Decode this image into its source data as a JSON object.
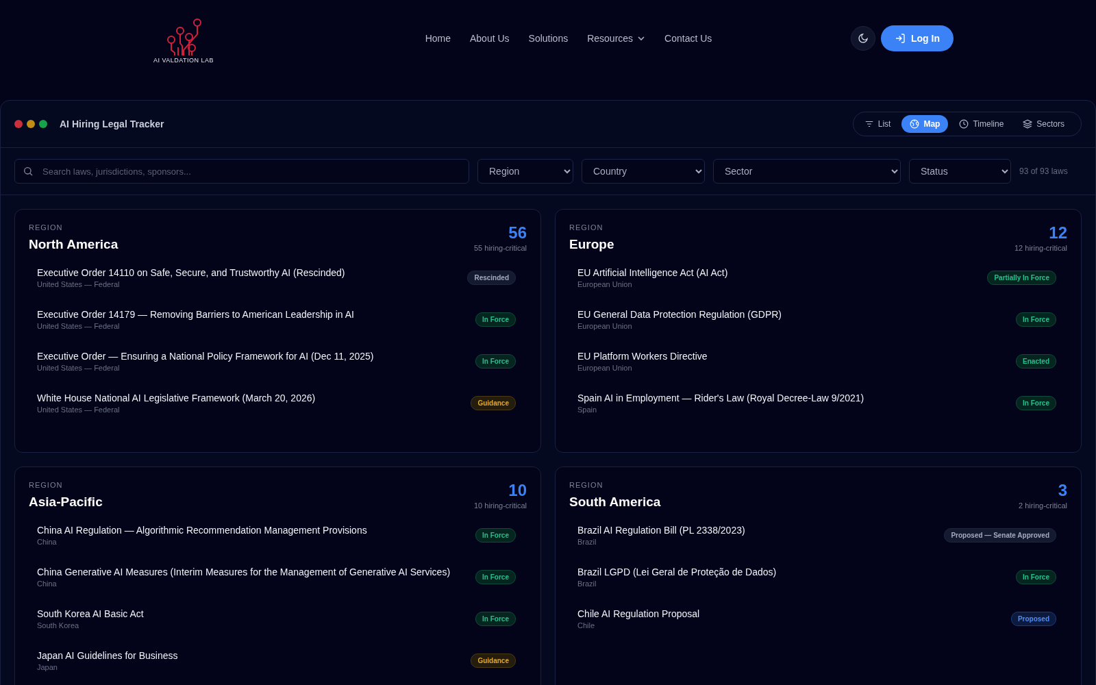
{
  "header": {
    "logo_text": "AI VALDATION LAB",
    "nav": [
      {
        "label": "Home",
        "dropdown": false
      },
      {
        "label": "About Us",
        "dropdown": false
      },
      {
        "label": "Solutions",
        "dropdown": false
      },
      {
        "label": "Resources",
        "dropdown": true
      },
      {
        "label": "Contact Us",
        "dropdown": false
      }
    ],
    "login_button": "Log In"
  },
  "tracker": {
    "title": "AI Hiring Legal Tracker",
    "view_tabs": [
      {
        "label": "List",
        "selected": false
      },
      {
        "label": "Map",
        "selected": true
      },
      {
        "label": "Timeline",
        "selected": false
      },
      {
        "label": "Sectors",
        "selected": false
      }
    ],
    "search": {
      "placeholder": "Search laws, jurisdictions, sponsors..."
    },
    "filters": [
      "Region",
      "Country",
      "Sector",
      "Status"
    ],
    "count": "93 of 93 laws",
    "regions": [
      {
        "label": "REGION",
        "name": "North America",
        "total": "56",
        "critical": "55 hiring-critical",
        "laws": [
          {
            "title": "Executive Order 14110 on Safe, Secure, and Trustworthy AI (Rescinded)",
            "jurisdiction": "United States — Federal",
            "status": "Rescinded",
            "kind": "neutral"
          },
          {
            "title": "Executive Order 14179 — Removing Barriers to American Leadership in AI",
            "jurisdiction": "United States — Federal",
            "status": "In Force",
            "kind": "active"
          },
          {
            "title": "Executive Order — Ensuring a National Policy Framework for AI (Dec 11, 2025)",
            "jurisdiction": "United States — Federal",
            "status": "In Force",
            "kind": "active"
          },
          {
            "title": "White House National AI Legislative Framework (March 20, 2026)",
            "jurisdiction": "United States — Federal",
            "status": "Guidance",
            "kind": "guidance"
          }
        ]
      },
      {
        "label": "REGION",
        "name": "Europe",
        "total": "12",
        "critical": "12 hiring-critical",
        "laws": [
          {
            "title": "EU Artificial Intelligence Act (AI Act)",
            "jurisdiction": "European Union",
            "status": "Partially In Force",
            "kind": "active"
          },
          {
            "title": "EU General Data Protection Regulation (GDPR)",
            "jurisdiction": "European Union",
            "status": "In Force",
            "kind": "active"
          },
          {
            "title": "EU Platform Workers Directive",
            "jurisdiction": "European Union",
            "status": "Enacted",
            "kind": "active"
          },
          {
            "title": "Spain AI in Employment — Rider's Law (Royal Decree-Law 9/2021)",
            "jurisdiction": "Spain",
            "status": "In Force",
            "kind": "active"
          }
        ]
      },
      {
        "label": "REGION",
        "name": "Asia-Pacific",
        "total": "10",
        "critical": "10 hiring-critical",
        "laws": [
          {
            "title": "China AI Regulation — Algorithmic Recommendation Management Provisions",
            "jurisdiction": "China",
            "status": "In Force",
            "kind": "active"
          },
          {
            "title": "China Generative AI Measures (Interim Measures for the Management of Generative AI Services)",
            "jurisdiction": "China",
            "status": "In Force",
            "kind": "active"
          },
          {
            "title": "South Korea AI Basic Act",
            "jurisdiction": "South Korea",
            "status": "In Force",
            "kind": "active"
          },
          {
            "title": "Japan AI Guidelines for Business",
            "jurisdiction": "Japan",
            "status": "Guidance",
            "kind": "guidance"
          }
        ]
      },
      {
        "label": "REGION",
        "name": "South America",
        "total": "3",
        "critical": "2 hiring-critical",
        "laws": [
          {
            "title": "Brazil AI Regulation Bill (PL 2338/2023)",
            "jurisdiction": "Brazil",
            "status": "Proposed — Senate Approved",
            "kind": "neutral"
          },
          {
            "title": "Brazil LGPD (Lei Geral de Proteção de Dados)",
            "jurisdiction": "Brazil",
            "status": "In Force",
            "kind": "active"
          },
          {
            "title": "Chile AI Regulation Proposal",
            "jurisdiction": "Chile",
            "status": "Proposed",
            "kind": "proposed"
          }
        ]
      }
    ]
  }
}
